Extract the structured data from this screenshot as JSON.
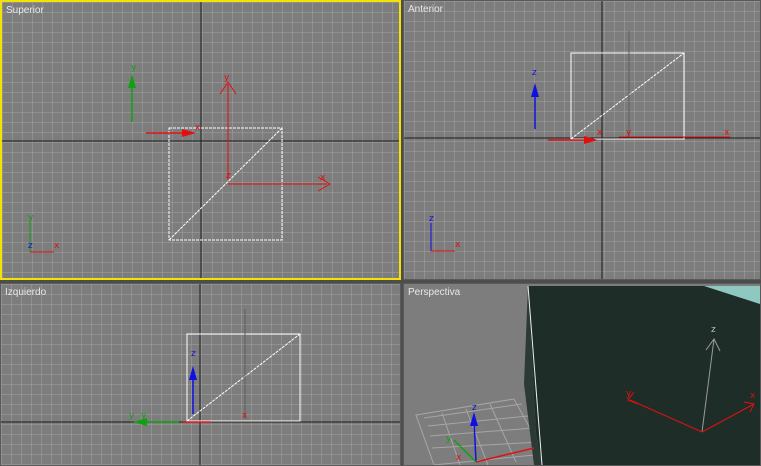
{
  "viewports": {
    "top": {
      "label": "Superior",
      "active": true
    },
    "front": {
      "label": "Anterior",
      "active": false
    },
    "left": {
      "label": "Izquierdo",
      "active": false
    },
    "perspective": {
      "label": "Perspectiva",
      "active": false
    }
  },
  "axis_labels": {
    "x": "x",
    "y": "y",
    "z": "z"
  },
  "colors": {
    "viewport_bg": "#7d7d7d",
    "grid": "#a0a0a0",
    "active_border": "#f2e400",
    "x_axis": "#e01010",
    "y_axis": "#10a010",
    "z_axis": "#1010e0",
    "object": "#ffffff",
    "box_face": "#1e2d28"
  }
}
